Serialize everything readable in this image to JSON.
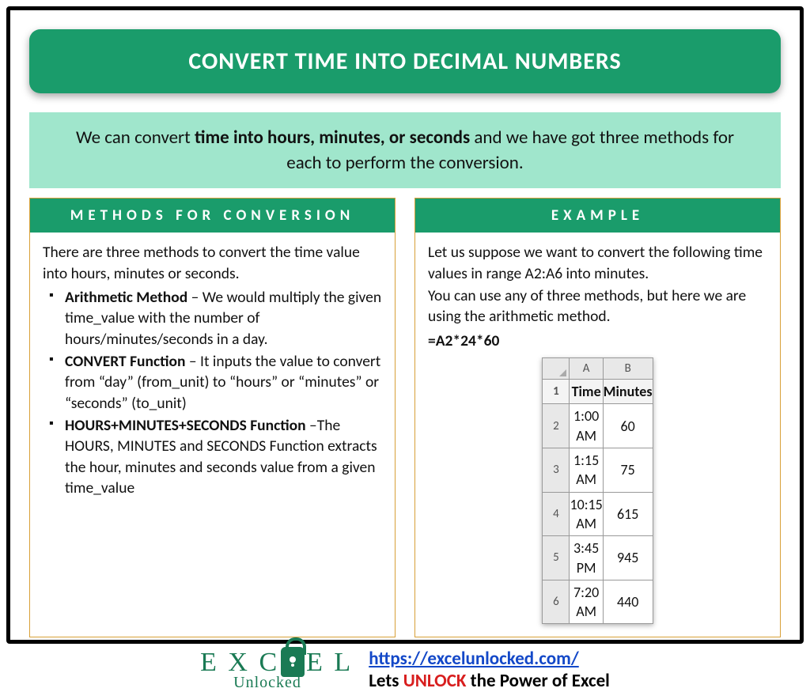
{
  "title": "CONVERT TIME INTO DECIMAL NUMBERS",
  "intro": {
    "prefix": "We can convert ",
    "bold": "time into hours, minutes, or seconds",
    "suffix": " and we have got three methods for each to perform the conversion."
  },
  "left": {
    "heading": "METHODS FOR CONVERSION",
    "lead": "There are three methods to convert the time value into hours, minutes or seconds.",
    "items": [
      {
        "name": "Arithmetic Method",
        "desc": " – We would multiply the given time_value with the number of hours/minutes/seconds in a day."
      },
      {
        "name": "CONVERT Function",
        "desc": " – It inputs the value to convert from “day” (from_unit) to “hours” or “minutes” or “seconds” (to_unit)"
      },
      {
        "name": "HOURS+MINUTES+SECONDS Function",
        "desc": " –The HOURS, MINUTES and SECONDS Function extracts the hour, minutes and seconds value from a given time_value"
      }
    ]
  },
  "right": {
    "heading": "EXAMPLE",
    "p1": "Let us suppose we want to convert the following time values in range A2:A6 into minutes.",
    "p2": "You can use any of three methods, but here we are using the arithmetic method.",
    "formula": "=A2*24*60",
    "table": {
      "cols": [
        "A",
        "B"
      ],
      "headers": [
        "Time",
        "Minutes"
      ],
      "rows": [
        {
          "n": "2",
          "a": "1:00 AM",
          "b": "60"
        },
        {
          "n": "3",
          "a": "1:15 AM",
          "b": "75"
        },
        {
          "n": "4",
          "a": "10:15 AM",
          "b": "615"
        },
        {
          "n": "5",
          "a": "3:45 PM",
          "b": "945"
        },
        {
          "n": "6",
          "a": "7:20 AM",
          "b": "440"
        }
      ]
    }
  },
  "footer": {
    "logo_top": "E X C E L",
    "logo_bottom": "Unlocked",
    "url": "https://excelunlocked.com/",
    "tag_pre": "Lets ",
    "tag_bold": "UNLOCK",
    "tag_post": " the Power of Excel"
  }
}
